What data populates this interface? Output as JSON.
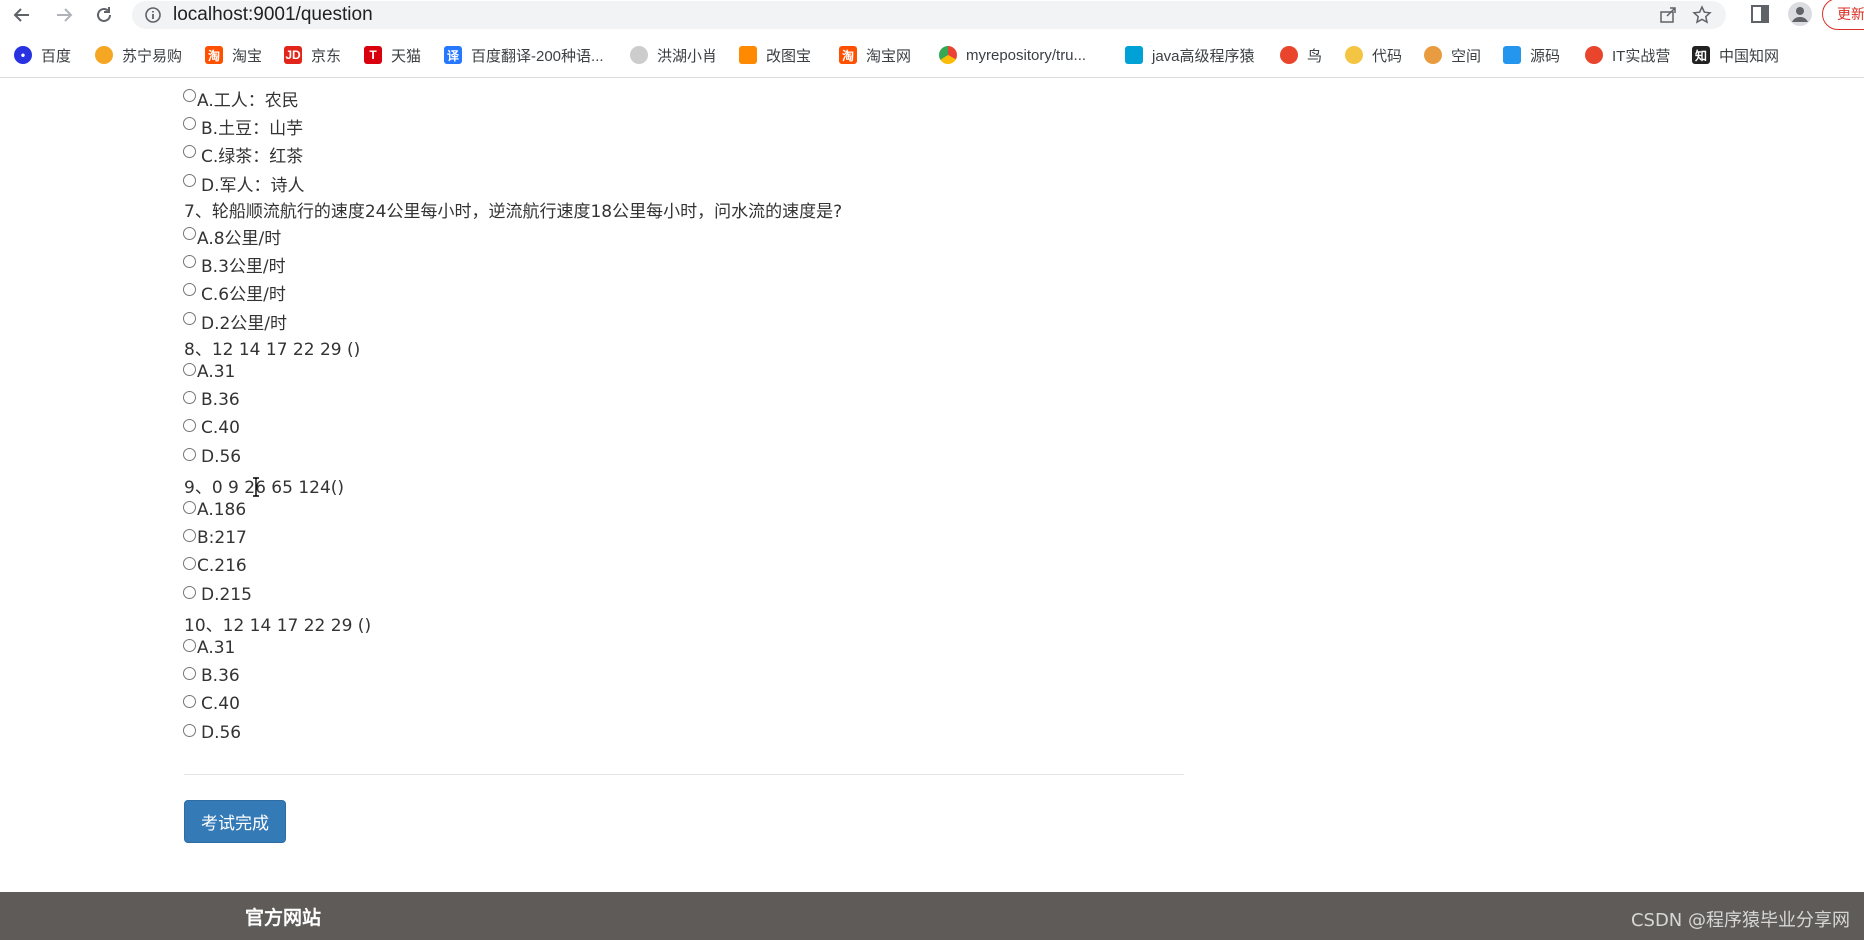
{
  "browser": {
    "url": "localhost:9001/question",
    "update_label": "更新",
    "bookmarks": [
      {
        "label": "百度",
        "icon": "baidu-paw-icon",
        "color": "#2932e1"
      },
      {
        "label": "苏宁易购",
        "icon": "suning-lion-icon",
        "color": "#f5a623"
      },
      {
        "label": "淘宝",
        "icon": "taobao-icon",
        "color": "#ff5000"
      },
      {
        "label": "京东",
        "icon": "jd-icon",
        "color": "#e1251b"
      },
      {
        "label": "天猫",
        "icon": "tmall-icon",
        "color": "#d8000f"
      },
      {
        "label": "百度翻译-200种语...",
        "icon": "translate-icon",
        "color": "#2878ff"
      },
      {
        "label": "洪湖小肖",
        "icon": "bird-icon",
        "color": "#888888"
      },
      {
        "label": "改图宝",
        "icon": "image-edit-icon",
        "color": "#ff8a00"
      },
      {
        "label": "淘宝网",
        "icon": "taobao-icon",
        "color": "#ff5000"
      },
      {
        "label": "myrepository/tru...",
        "icon": "chrome-icon",
        "color": "#4285f4"
      },
      {
        "label": "java高级程序猿",
        "icon": "bilibili-icon",
        "color": "#00a1d6"
      },
      {
        "label": "鸟",
        "icon": "bird-icon",
        "color": "#e8452c"
      },
      {
        "label": "代码",
        "icon": "code-icon",
        "color": "#f4c542"
      },
      {
        "label": "空间",
        "icon": "qzone-icon",
        "color": "#e89c3f"
      },
      {
        "label": "源码",
        "icon": "docker-icon",
        "color": "#2496ed"
      },
      {
        "label": "IT实战营",
        "icon": "chrome-red-icon",
        "color": "#e8452c"
      },
      {
        "label": "中国知网",
        "icon": "cnki-icon",
        "color": "#222222"
      }
    ]
  },
  "questions": [
    {
      "text": "",
      "options": [
        "A.工人：农民",
        "B.土豆：山芋",
        "C.绿茶：红茶",
        "D.军人：诗人"
      ]
    },
    {
      "text": "7、轮船顺流航行的速度24公里每小时，逆流航行速度18公里每小时，问水流的速度是?",
      "options": [
        "A.8公里/时",
        "B.3公里/时",
        "C.6公里/时",
        "D.2公里/时"
      ]
    },
    {
      "text": "8、12 14 17 22 29 ()",
      "options": [
        "A.31",
        "B.36",
        "C.40",
        "D.56"
      ]
    },
    {
      "text": "9、0 9 26 65 124()",
      "options": [
        "A.186",
        "B:217",
        "C.216",
        "D.215"
      ]
    },
    {
      "text": "10、12 14 17 22 29 ()",
      "options": [
        "A.31",
        "B.36",
        "C.40",
        "D.56"
      ]
    }
  ],
  "submit_label": "考试完成",
  "footer": {
    "link": "官方网站",
    "watermark": "CSDN @程序猿毕业分享网"
  }
}
